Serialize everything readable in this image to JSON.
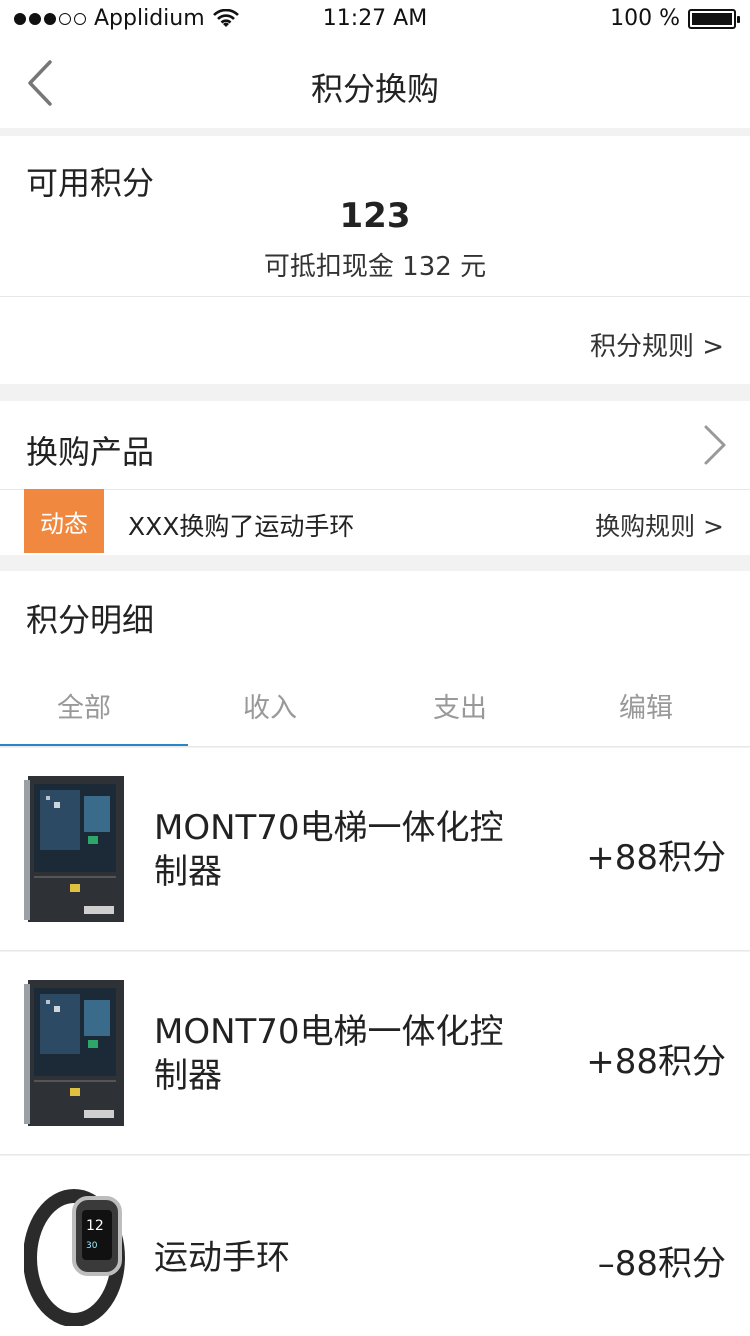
{
  "status_bar": {
    "carrier": "Applidium",
    "time": "11:27 AM",
    "battery": "100 %"
  },
  "nav": {
    "title": "积分换购"
  },
  "points": {
    "label": "可用积分",
    "value": "123",
    "cash_text": "可抵扣现金 132 元",
    "rule_link": "积分规则 >"
  },
  "exchange": {
    "title": "换购产品",
    "badge": "动态",
    "feed_text": "XXX换购了运动手环",
    "rule_link": "换购规则 >"
  },
  "details": {
    "title": "积分明细",
    "tabs": [
      "全部",
      "收入",
      "支出",
      "编辑"
    ],
    "items": [
      {
        "name": "MONT70电梯一体化控制器",
        "points": "+88积分",
        "icon": "controller-image"
      },
      {
        "name": "MONT70电梯一体化控制器",
        "points": "+88积分",
        "icon": "controller-image"
      },
      {
        "name": "运动手环",
        "points": "–88积分",
        "icon": "fitness-band-image"
      }
    ]
  },
  "colors": {
    "accent_tab": "#2b86c5",
    "badge_bg": "#f0893f"
  }
}
